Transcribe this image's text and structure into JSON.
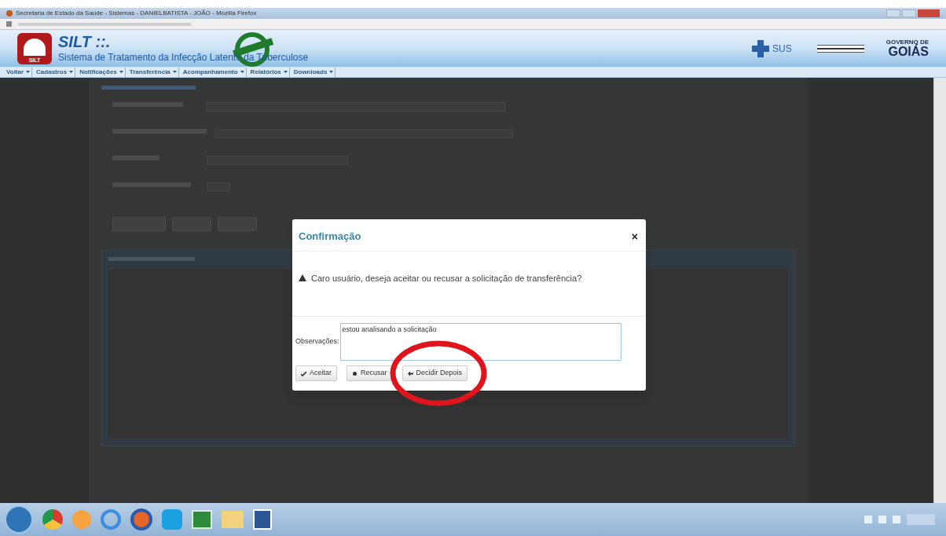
{
  "window": {
    "title": "Secretaria de Estado da Saúde - Sistemas - DANIELBATISTA - JOÃO - Mozilla Firefox"
  },
  "header": {
    "app_name": "SILT ::.",
    "subtitle": "Sistema de Tratamento da Infecção Latente da Tuberculose",
    "logo_text": "SILT",
    "partners": [
      {
        "kind": "sus",
        "label": "SUS"
      },
      {
        "kind": "goias",
        "top": "GOVERNO DE",
        "label": "GOIÁS"
      }
    ]
  },
  "menu": [
    "Voltar",
    "Cadastros",
    "Notificações",
    "Transferência",
    "Acompanhamento",
    "Relatórios",
    "Downloads"
  ],
  "dialog": {
    "title": "Confirmação",
    "close": "×",
    "message": "Caro usuário, deseja aceitar ou recusar a solicitação de transferência?",
    "observations_label": "Observações:",
    "observations_value": "estou analisando a solicitação",
    "buttons": [
      {
        "kind": "accept",
        "label": "Aceitar"
      },
      {
        "kind": "refuse",
        "label": "Recusar"
      },
      {
        "kind": "later",
        "label": "Decidir Depois"
      }
    ]
  }
}
